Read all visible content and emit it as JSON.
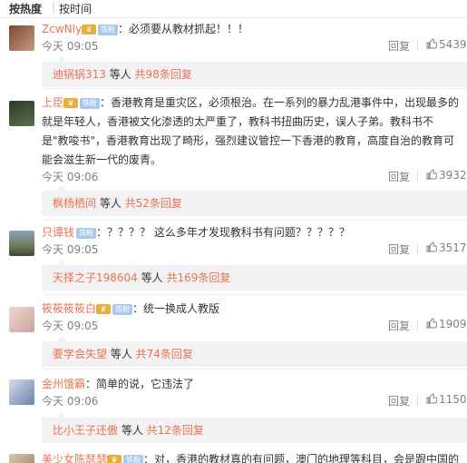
{
  "sort": {
    "hot": "按热度",
    "sep": "|",
    "time": "按时间"
  },
  "badge_text": "铁粉",
  "reply_label": "回复",
  "comments": [
    {
      "user": "ZcwNly",
      "text": "：必须要从教材抓起！！！",
      "time": "今天 09:05",
      "likes": "5439",
      "reply_user": "迪锅锅313",
      "reply_mid": " 等人 ",
      "reply_count": "共98条回复"
    },
    {
      "user": "上臣",
      "text": "：香港教育是重灾区，必须根治。在一系列的暴力乱港事件中，出现最多的就是年轻人，香港被文化渗透的太严重了，教科书扭曲历史，误人子弟。教科书不是\"教唆书\"，香港教育出现了畸形，强烈建议管控一下香港的教育，高度自治的教育可能会滋生新一代的废青。",
      "time": "今天 09:06",
      "likes": "3932",
      "reply_user": "枫杨栖间",
      "reply_mid": " 等人 ",
      "reply_count": "共52条回复"
    },
    {
      "user": "只谭钱",
      "text": "：？？？？ 这么多年才发现教科书有问题？？？？？",
      "time": "今天 09:05",
      "likes": "3517",
      "reply_user": "天择之子198604",
      "reply_mid": " 等人 ",
      "reply_count": "共169条回复"
    },
    {
      "user": "筱筱筱筱白",
      "text": "：统一换成人教版",
      "time": "今天 09:05",
      "likes": "1909",
      "reply_user": "要学会失望",
      "reply_mid": " 等人 ",
      "reply_count": "共74条回复"
    },
    {
      "user": "金州饿霸",
      "text": "：简单的说，它违法了",
      "time": "今天 09:06",
      "likes": "1150",
      "reply_user": "比小王子还傲",
      "reply_mid": " 等人 ",
      "reply_count": "共12条回复"
    },
    {
      "user": "美少女陈瑟瑟",
      "text": "：对，香港的教材真的有问题，澳门的地理等科目，会是跟中国的"
    }
  ],
  "colors": {
    "username": "#eb7350",
    "meta": "#808080",
    "reply_bg": "#f2f2f5"
  }
}
